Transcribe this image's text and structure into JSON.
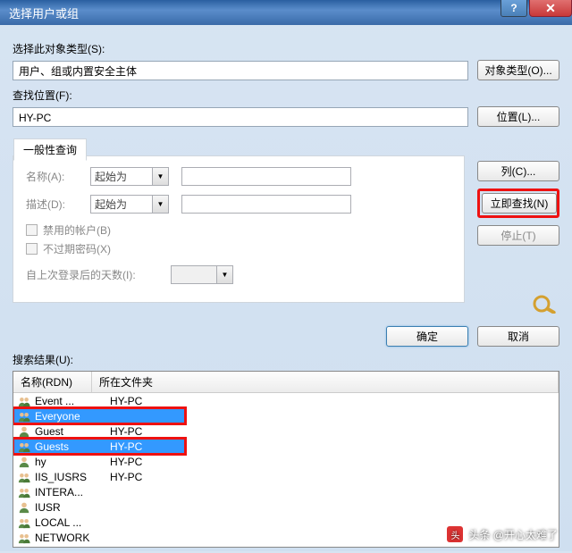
{
  "title": "选择用户或组",
  "section_object_type": {
    "label": "选择此对象类型(S):",
    "value": "用户、组或内置安全主体",
    "button": "对象类型(O)..."
  },
  "section_location": {
    "label": "查找位置(F):",
    "value": "HY-PC",
    "button": "位置(L)..."
  },
  "common_query": {
    "tab": "一般性查询",
    "name_label": "名称(A):",
    "name_op": "起始为",
    "desc_label": "描述(D):",
    "desc_op": "起始为",
    "chk_disabled": "禁用的帐户(B)",
    "chk_noexpire": "不过期密码(X)",
    "days_label": "自上次登录后的天数(I):"
  },
  "side_buttons": {
    "columns": "列(C)...",
    "find_now": "立即查找(N)",
    "stop": "停止(T)"
  },
  "actions": {
    "ok": "确定",
    "cancel": "取消"
  },
  "results": {
    "label": "搜索结果(U):",
    "col1": "名称(RDN)",
    "col2": "所在文件夹",
    "rows": [
      {
        "name": "Event ...",
        "folder": "HY-PC",
        "type": "group",
        "selected": false,
        "highlighted": false
      },
      {
        "name": "Everyone",
        "folder": "",
        "type": "group",
        "selected": true,
        "highlighted": true
      },
      {
        "name": "Guest",
        "folder": "HY-PC",
        "type": "user",
        "selected": false,
        "highlighted": false
      },
      {
        "name": "Guests",
        "folder": "HY-PC",
        "type": "group",
        "selected": true,
        "highlighted": true
      },
      {
        "name": "hy",
        "folder": "HY-PC",
        "type": "user",
        "selected": false,
        "highlighted": false
      },
      {
        "name": "IIS_IUSRS",
        "folder": "HY-PC",
        "type": "group",
        "selected": false,
        "highlighted": false
      },
      {
        "name": "INTERA...",
        "folder": "",
        "type": "group",
        "selected": false,
        "highlighted": false
      },
      {
        "name": "IUSR",
        "folder": "",
        "type": "user",
        "selected": false,
        "highlighted": false
      },
      {
        "name": "LOCAL ...",
        "folder": "",
        "type": "group",
        "selected": false,
        "highlighted": false
      },
      {
        "name": "NETWORK",
        "folder": "",
        "type": "group",
        "selected": false,
        "highlighted": false
      }
    ]
  },
  "watermark": "头条 @开心太难了"
}
